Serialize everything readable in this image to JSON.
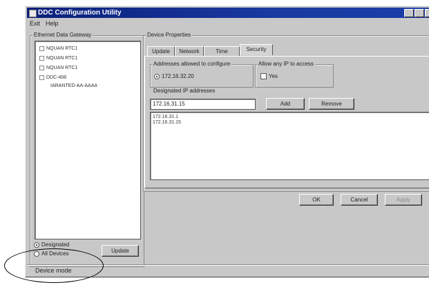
{
  "window": {
    "title": "DDC Configuration Utility"
  },
  "menu": [
    "Exit",
    "Help"
  ],
  "left_panel": {
    "group_label": "Ethernet Data Gateway",
    "tree": [
      "NQUAN RTC1",
      "NQUAN RTC1",
      "NQUAN RTC1",
      "DDC-408",
      "IARANTED-AA-AAAA"
    ],
    "radios": [
      {
        "label": "Designated",
        "selected": true
      },
      {
        "label": "All Devices",
        "selected": false
      }
    ],
    "update_button": "Update"
  },
  "right_panel": {
    "group_label": "Device Properties",
    "tabs": [
      "Update",
      "Network",
      "Time",
      "Security"
    ],
    "active_tab": "Security",
    "section1_label": "Addresses allowed to configure",
    "section2_label": "Allow any IP to access",
    "radio1_label": "172.16.32.20",
    "checkbox_label": "Yes",
    "designated_label": "Designated IP addresses",
    "ip_input_value": "172.16.31.15",
    "add_button": "Add",
    "remove_button": "Remove",
    "list_items": [
      "172.16.31.1",
      "172.16.31.15"
    ],
    "ok_button": "OK",
    "cancel_button": "Cancel",
    "apply_button": "Apply"
  },
  "status": {
    "text": "Device mode"
  }
}
